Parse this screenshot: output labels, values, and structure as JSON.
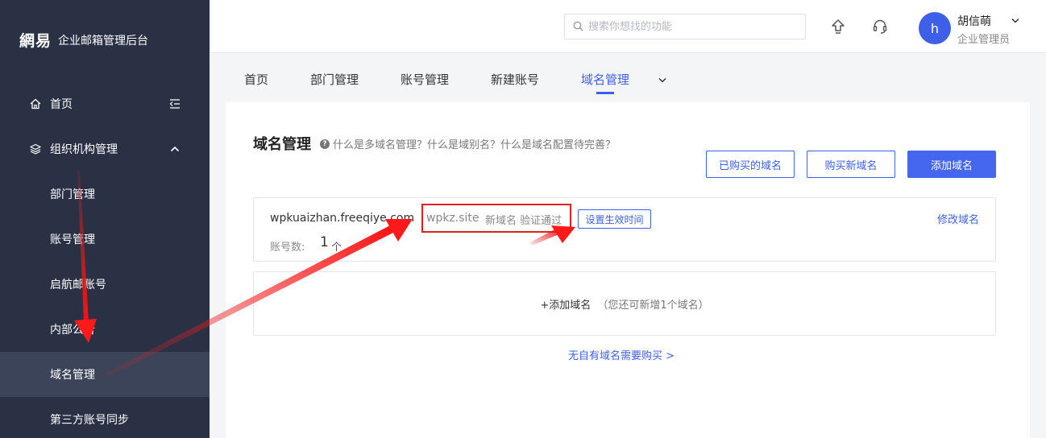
{
  "sidebar": {
    "brand_logo": "網易",
    "brand_text": "企业邮箱管理后台",
    "items": [
      {
        "label": "首页"
      },
      {
        "label": "组织机构管理"
      },
      {
        "label": "部门管理"
      },
      {
        "label": "账号管理"
      },
      {
        "label": "启航邮账号"
      },
      {
        "label": "内部公告"
      },
      {
        "label": "域名管理"
      },
      {
        "label": "第三方账号同步"
      }
    ]
  },
  "header": {
    "search_placeholder": "搜索你想找的功能",
    "user": {
      "initial": "h",
      "name": "胡信萌",
      "role": "企业管理员"
    }
  },
  "tabs": [
    {
      "label": "首页"
    },
    {
      "label": "部门管理"
    },
    {
      "label": "账号管理"
    },
    {
      "label": "新建账号"
    },
    {
      "label": "域名管理",
      "active": true
    }
  ],
  "main": {
    "title": "域名管理",
    "help_text": "什么是多域名管理？什么是域别名？什么是域名配置待完善？",
    "buttons": {
      "purchased": "已购买的域名",
      "buy_new": "购买新域名",
      "add": "添加域名"
    },
    "domain": {
      "name": "wpkuaizhan.freeqiye.com",
      "alias": "wpkz.site",
      "alias_status": "新域名 验证通过",
      "set_time": "设置生效时间",
      "edit": "修改域名",
      "account_label": "账号数:",
      "account_count": "1",
      "account_unit": "个"
    },
    "add_domain": {
      "label": "+添加域名",
      "hint": "（您还可新增1个域名）"
    },
    "no_domain_link": "无自有域名需要购买 >"
  },
  "colors": {
    "sidebar_bg": "#2a3145",
    "accent": "#3e5fe8",
    "annotation_red": "#e02020"
  }
}
